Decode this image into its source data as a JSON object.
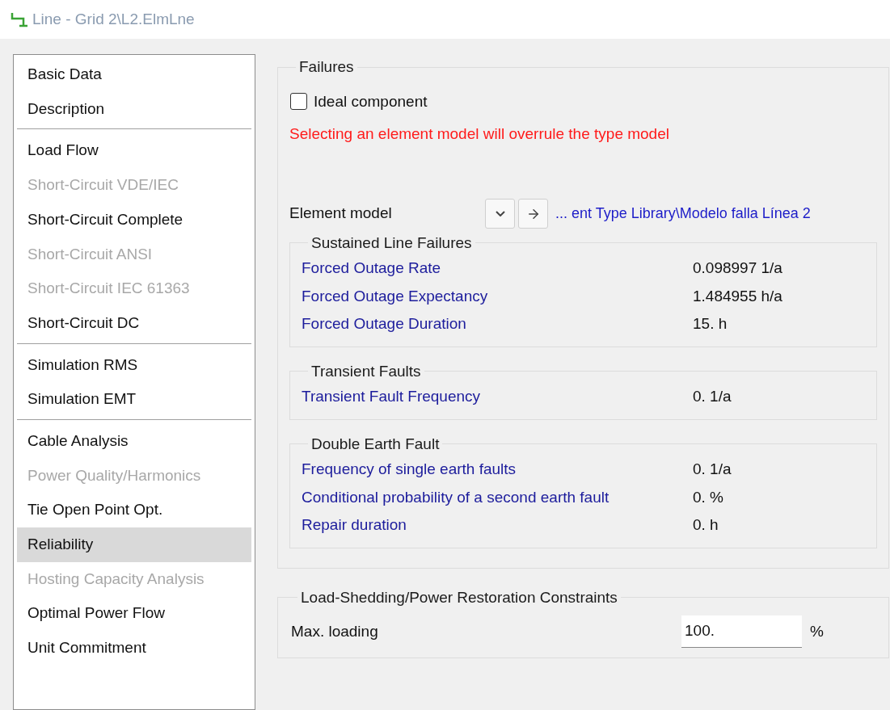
{
  "window": {
    "title": "Line - Grid 2\\L2.ElmLne"
  },
  "sidebar": {
    "groups": [
      [
        {
          "label": "Basic Data",
          "disabled": false,
          "selected": false
        },
        {
          "label": "Description",
          "disabled": false,
          "selected": false
        }
      ],
      [
        {
          "label": "Load Flow",
          "disabled": false,
          "selected": false
        },
        {
          "label": "Short-Circuit VDE/IEC",
          "disabled": true,
          "selected": false
        },
        {
          "label": "Short-Circuit Complete",
          "disabled": false,
          "selected": false
        },
        {
          "label": "Short-Circuit ANSI",
          "disabled": true,
          "selected": false
        },
        {
          "label": "Short-Circuit IEC 61363",
          "disabled": true,
          "selected": false
        },
        {
          "label": "Short-Circuit DC",
          "disabled": false,
          "selected": false
        }
      ],
      [
        {
          "label": "Simulation RMS",
          "disabled": false,
          "selected": false
        },
        {
          "label": "Simulation EMT",
          "disabled": false,
          "selected": false
        }
      ],
      [
        {
          "label": "Cable Analysis",
          "disabled": false,
          "selected": false
        },
        {
          "label": "Power Quality/Harmonics",
          "disabled": true,
          "selected": false
        },
        {
          "label": "Tie Open Point Opt.",
          "disabled": false,
          "selected": false
        },
        {
          "label": "Reliability",
          "disabled": false,
          "selected": true
        },
        {
          "label": "Hosting Capacity Analysis",
          "disabled": true,
          "selected": false
        },
        {
          "label": "Optimal Power Flow",
          "disabled": false,
          "selected": false
        },
        {
          "label": "Unit Commitment",
          "disabled": false,
          "selected": false
        }
      ]
    ]
  },
  "failures": {
    "title": "Failures",
    "ideal_component": {
      "label": "Ideal component",
      "checked": false
    },
    "warning": "Selecting an element model will overrule the type model",
    "element_model": {
      "label": "Element model",
      "path": "... ent Type Library\\Modelo falla Línea 2"
    },
    "sections": [
      {
        "title": "Sustained Line Failures",
        "rows": [
          {
            "label": "Forced Outage Rate",
            "value": "0.098997 1/a"
          },
          {
            "label": "Forced Outage Expectancy",
            "value": "1.484955 h/a"
          },
          {
            "label": "Forced Outage Duration",
            "value": "15. h"
          }
        ]
      },
      {
        "title": "Transient Faults",
        "rows": [
          {
            "label": "Transient Fault Frequency",
            "value": "0. 1/a"
          }
        ]
      },
      {
        "title": "Double Earth Fault",
        "rows": [
          {
            "label": "Frequency of single earth faults",
            "value": "0. 1/a"
          },
          {
            "label": "Conditional probability of a second earth fault",
            "value": "0. %"
          },
          {
            "label": "Repair duration",
            "value": "0. h"
          }
        ]
      }
    ]
  },
  "constraints": {
    "title": "Load-Shedding/Power Restoration Constraints",
    "max_loading": {
      "label": "Max. loading",
      "value": "100.",
      "unit": "%"
    }
  }
}
